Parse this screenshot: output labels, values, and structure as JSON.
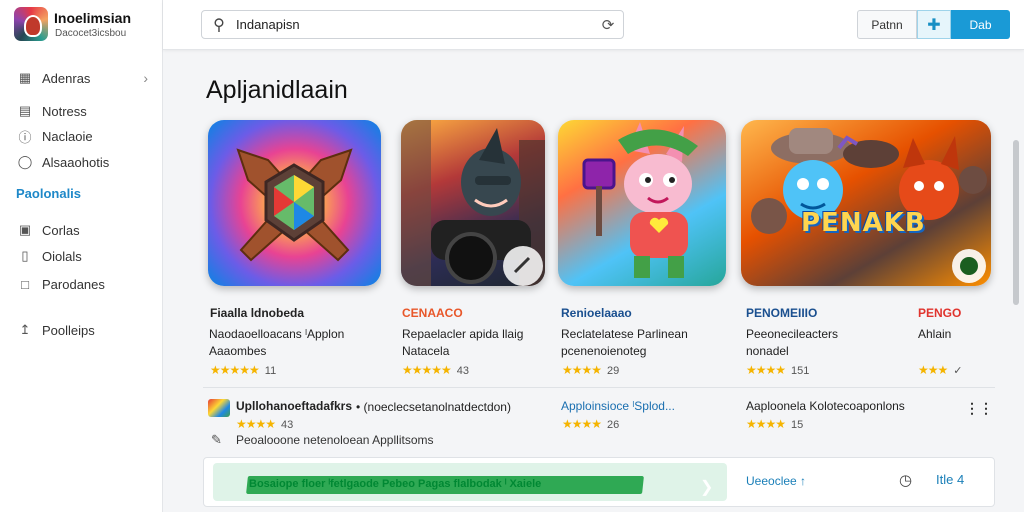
{
  "app": {
    "title": "Inoelimsian",
    "subtitle": "Dacocet3icsbou"
  },
  "sidebar": {
    "items": [
      {
        "label": "Adenras",
        "icon": "grid-icon",
        "has_chevron": true
      },
      {
        "label": "Notress",
        "icon": "list-icon"
      },
      {
        "label": "Naclaoie",
        "icon": "info-circle-icon"
      },
      {
        "label": "Alsaaohotis",
        "icon": "tag-icon"
      }
    ],
    "section_label": "Paolonalis",
    "items2": [
      {
        "label": "Corlas",
        "icon": "square-icon"
      },
      {
        "label": "Oiolals",
        "icon": "window-icon"
      },
      {
        "label": "Parodanes",
        "icon": "document-icon"
      },
      {
        "label": "Poolleips",
        "icon": "share-icon"
      }
    ]
  },
  "search": {
    "value": "Indanapisn"
  },
  "toolbar": {
    "plain_label": "Patnn",
    "primary_label": "Dab"
  },
  "main": {
    "title": "Apljanidlaain",
    "tile_word": "PENAKB",
    "cards": [
      {
        "title": "Fiaalla ldnobeda",
        "line1": "Naodaoelloacans ˡApplon",
        "line2": "Aaaombes",
        "rating_stars": "★★★★★",
        "rating": "11",
        "title_color": "#111111"
      },
      {
        "title": "CENAACO",
        "line1": "Repaelacler apida llaig",
        "line2": "Natacela",
        "rating_stars": "★★★★★",
        "rating": "43",
        "title_color": "#e8572a"
      },
      {
        "title": "Renioelaaao",
        "line1": "Reclatelatese Parlinean",
        "line2": "pcenenoienoteg",
        "rating_stars": "★★★★",
        "rating": "29",
        "title_color": "#1a4f8f"
      },
      {
        "title": "PENOMEIIIO",
        "line1": "Peeonecileacters",
        "line2": "nonadel",
        "rating_stars": "★★★★",
        "rating": "151",
        "title_color": "#1a4f8f"
      },
      {
        "title": "PENGO",
        "line1": "Ahlain",
        "line2": "",
        "rating_stars": "★★★",
        "rating": "✓",
        "title_color": "#e0342e"
      }
    ],
    "row2": [
      {
        "title": "Upllohanoeftadafkrs",
        "extra": "•  (noeclecsetanolnatdectdon)",
        "rating_stars": "★★★★",
        "rating": "43",
        "desc": "Peoalooone netenoloean Appllitsoms"
      },
      {
        "title": "Apploinsioce ˡSplod...",
        "rating_stars": "★★★★",
        "rating": "26"
      },
      {
        "title": "Aaploonela Kolotecoaponlons",
        "rating_stars": "★★★★",
        "rating": "15"
      }
    ]
  },
  "banner": {
    "text": "Bosaiope  floer  ˡfetlgaode        Pebeo Pagas flalbodak  ˡ        Xaiele",
    "link": "Ueeoclee ↑",
    "count": "Itle 4"
  },
  "colors": {
    "accent": "#1a9ad6",
    "banner_green": "#1fa347",
    "star": "#f5b400"
  }
}
